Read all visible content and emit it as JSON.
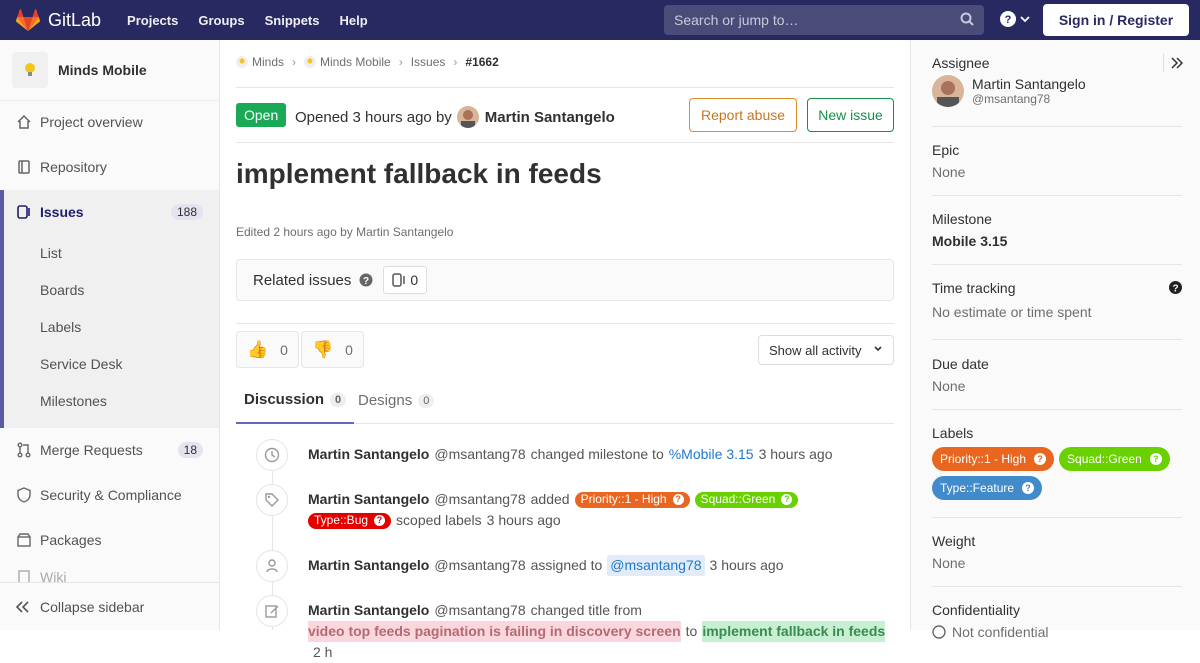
{
  "topbar": {
    "brand": "GitLab",
    "nav": [
      "Projects",
      "Groups",
      "Snippets",
      "Help"
    ],
    "search_placeholder": "Search or jump to…",
    "signin_label": "Sign in / Register"
  },
  "sidebar": {
    "project_name": "Minds Mobile",
    "items": {
      "overview": "Project overview",
      "repository": "Repository",
      "issues": "Issues",
      "issues_count": "188",
      "list": "List",
      "boards": "Boards",
      "labels": "Labels",
      "service_desk": "Service Desk",
      "milestones": "Milestones",
      "merge_requests": "Merge Requests",
      "mr_count": "18",
      "security": "Security & Compliance",
      "packages": "Packages",
      "wiki": "Wiki"
    },
    "collapse_label": "Collapse sidebar"
  },
  "breadcrumb": {
    "group": "Minds",
    "project": "Minds Mobile",
    "section": "Issues",
    "current": "#1662"
  },
  "issue": {
    "status": "Open",
    "opened_text": "Opened 3 hours ago by",
    "author": "Martin Santangelo",
    "report_label": "Report abuse",
    "new_issue_label": "New issue",
    "title": "implement fallback in feeds",
    "edited": "Edited 2 hours ago by Martin Santangelo",
    "related_label": "Related issues",
    "related_count": "0",
    "thumbs_up": "0",
    "thumbs_down": "0",
    "activity_filter": "Show all activity"
  },
  "tabs": {
    "discussion": "Discussion",
    "discussion_count": "0",
    "designs": "Designs",
    "designs_count": "0"
  },
  "notes": [
    {
      "who": "Martin Santangelo",
      "handle": "@msantang78",
      "action": "changed milestone to",
      "link": "%Mobile 3.15",
      "time": "3 hours ago"
    },
    {
      "who": "Martin Santangelo",
      "handle": "@msantang78",
      "action": "added",
      "labels": [
        "Priority::1 - High",
        "Squad::Green",
        "Type::Bug"
      ],
      "suffix": "scoped labels",
      "time": "3 hours ago"
    },
    {
      "who": "Martin Santangelo",
      "handle": "@msantang78",
      "action": "assigned to",
      "mention": "@msantang78",
      "time": "3 hours ago"
    },
    {
      "who": "Martin Santangelo",
      "handle": "@msantang78",
      "action": "changed title from",
      "from": "video top feeds pagination is failing in discovery screen",
      "to_word": "to",
      "to": "implement fallback in feeds",
      "time": "2 h"
    }
  ],
  "right": {
    "assignee_title": "Assignee",
    "assignee_name": "Martin Santangelo",
    "assignee_handle": "@msantang78",
    "epic_title": "Epic",
    "epic_val": "None",
    "milestone_title": "Milestone",
    "milestone_val": "Mobile 3.15",
    "time_title": "Time tracking",
    "time_val": "No estimate or time spent",
    "due_title": "Due date",
    "due_val": "None",
    "labels_title": "Labels",
    "labels": [
      "Priority::1 - High",
      "Squad::Green",
      "Type::Feature"
    ],
    "weight_title": "Weight",
    "weight_val": "None",
    "conf_title": "Confidentiality",
    "conf_val": "Not confidential"
  },
  "colors": {
    "topbar": "#292961",
    "open": "#1aaa55",
    "priority": "#e8661f",
    "squad_green": "#69d100",
    "type_bug": "#e50000",
    "type_feature": "#428bca"
  }
}
